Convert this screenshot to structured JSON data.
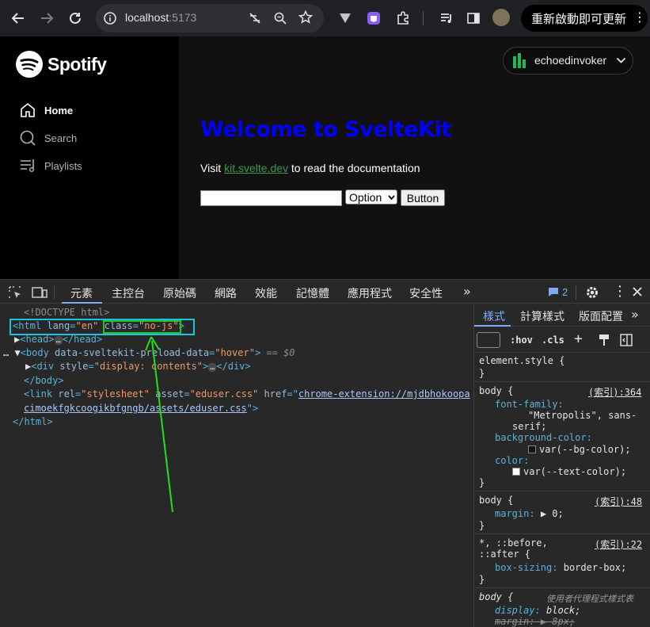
{
  "browser": {
    "url_host": "localhost",
    "url_port": ":5173",
    "relaunch_label": "重新啟動即可更新",
    "icons": [
      "back-icon",
      "forward-icon",
      "reload-icon",
      "site-info-icon",
      "no-tracking-icon",
      "zoom-icon",
      "star-icon",
      "extension-icon",
      "extension-puzzle-icon",
      "media-icon",
      "sidebar-icon",
      "profile-avatar",
      "kebab-menu-icon"
    ]
  },
  "app": {
    "logo_text": "Spotify",
    "nav": [
      {
        "label": "Home",
        "icon": "home-icon"
      },
      {
        "label": "Search",
        "icon": "search-icon"
      },
      {
        "label": "Playlists",
        "icon": "playlists-icon"
      }
    ],
    "user_name": "echoedinvoker",
    "welcome": "Welcome to SvelteKit",
    "visit_prefix": "Visit ",
    "visit_link": "kit.svelte.dev",
    "visit_suffix": " to read the documentation",
    "select_value": "Option",
    "button_label": "Button",
    "colors": {
      "heading": "#0000ff",
      "link": "#3a9b4b",
      "accent": "#1db954"
    }
  },
  "devtools": {
    "tabs": [
      "元素",
      "主控台",
      "原始碼",
      "網路",
      "效能",
      "記憶體",
      "應用程式",
      "安全性"
    ],
    "issues_count": "2",
    "dom": {
      "doctype": "<!DOCTYPE html>",
      "html_open": "<html",
      "html_lang_attr": "lang",
      "html_lang_val": "\"en\"",
      "html_class_attr": "class",
      "html_class_val": "\"no-js\"",
      "head": "<head>",
      "head_close": "</head>",
      "body_open": "<body",
      "body_attr": "data-sveltekit-preload-data",
      "body_val": "\"hover\"",
      "body_eq": "== $0",
      "div_open": "<div",
      "div_attr": "style",
      "div_val": "\"display: contents\"",
      "div_close": "</div>",
      "body_close": "</body>",
      "link_open": "<link",
      "link_rel": "rel",
      "link_rel_val": "\"stylesheet\"",
      "link_asset": "asset",
      "link_asset_val": "\"eduser.css\"",
      "link_href": "href",
      "link_href_val1": "chrome-extension://mjdbhokoopa",
      "link_href_val2": "cimoekfgkcoogikbfgngb/assets/eduser.css",
      "html_close": "</html>"
    },
    "styles": {
      "tabs": [
        "樣式",
        "計算樣式",
        "版面配置"
      ],
      "filter_hov": ":hov",
      "filter_cls": ".cls",
      "element_style": "element.style {",
      "rules": [
        {
          "selector": "body {",
          "source": "(索引):364"
        },
        {
          "selector": "body {",
          "source": "(索引):48"
        },
        {
          "selector": "*, ::before,",
          "selector2": "::after {",
          "source": "(索引):22"
        },
        {
          "selector": "body {",
          "source": "使用者代理程式樣式表"
        }
      ],
      "font_family_prop": "font-family:",
      "font_family_val1": "\"Metropolis\", sans-",
      "font_family_val2": "serif;",
      "bg_prop": "background-color:",
      "bg_val": "var(--bg-color);",
      "color_prop": "color:",
      "color_val": "var(--text-color);",
      "margin_prop": "margin:",
      "margin_val": "0;",
      "box_prop": "box-sizing:",
      "box_val": "border-box;",
      "display_prop": "display:",
      "display_val": "block;",
      "margin8_prop": "margin:",
      "margin8_val": "8px;"
    }
  }
}
